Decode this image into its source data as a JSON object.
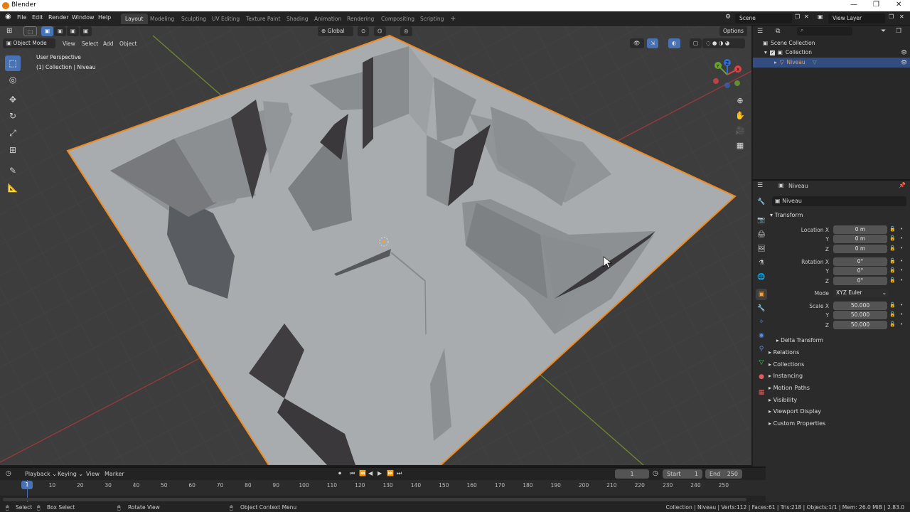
{
  "window": {
    "title": "Blender"
  },
  "menus": [
    "File",
    "Edit",
    "Render",
    "Window",
    "Help"
  ],
  "workspaces": [
    "Layout",
    "Modeling",
    "Sculpting",
    "UV Editing",
    "Texture Paint",
    "Shading",
    "Animation",
    "Rendering",
    "Compositing",
    "Scripting",
    "+"
  ],
  "scene": {
    "name": "Scene",
    "view_layer": "View Layer"
  },
  "viewport": {
    "mode": "Object Mode",
    "menus": [
      "View",
      "Select",
      "Add",
      "Object"
    ],
    "orientation": "Global",
    "options": "Options",
    "perspective": "User Perspective",
    "collection_info": "(1) Collection | Niveau",
    "gizmo": {
      "x": "X",
      "y": "Y",
      "z": "Z"
    }
  },
  "outliner": {
    "rows": [
      {
        "label": "Scene Collection"
      },
      {
        "label": "Collection"
      },
      {
        "label": "Niveau"
      }
    ]
  },
  "properties": {
    "object_name": "Niveau",
    "data_name": "Niveau",
    "transform_title": "Transform",
    "location_label": "Location X",
    "y_label": "Y",
    "z_label": "Z",
    "location": [
      "0 m",
      "0 m",
      "0 m"
    ],
    "rotation_label": "Rotation X",
    "rotation": [
      "0°",
      "0°",
      "0°"
    ],
    "mode_label": "Mode",
    "mode_value": "XYZ Euler",
    "scale_label": "Scale X",
    "scale": [
      "50.000",
      "50.000",
      "50.000"
    ],
    "delta": "Delta Transform",
    "sections": [
      "Relations",
      "Collections",
      "Instancing",
      "Motion Paths",
      "Visibility",
      "Viewport Display",
      "Custom Properties"
    ]
  },
  "timeline": {
    "menus": [
      "Playback",
      "Keying",
      "View",
      "Marker"
    ],
    "current_frame": "1",
    "start_label": "Start",
    "start": "1",
    "end_label": "End",
    "end": "250",
    "ticks": [
      "1",
      "10",
      "20",
      "30",
      "40",
      "50",
      "60",
      "70",
      "80",
      "90",
      "100",
      "110",
      "120",
      "130",
      "140",
      "150",
      "160",
      "170",
      "180",
      "190",
      "200",
      "210",
      "220",
      "230",
      "240",
      "250"
    ]
  },
  "statusbar": {
    "select": "Select",
    "box_select": "Box Select",
    "rotate_view": "Rotate View",
    "context_menu": "Object Context Menu",
    "stats": "Collection | Niveau | Verts:112 | Faces:61 | Tris:218 | Objects:1/1 | Mem: 26.0 MiB | 2.83.0"
  },
  "colors": {
    "accent": "#4772b3",
    "selection_outline": "#f08a1d",
    "header": "#232323",
    "viewport_bg": "#3d3d3d"
  }
}
